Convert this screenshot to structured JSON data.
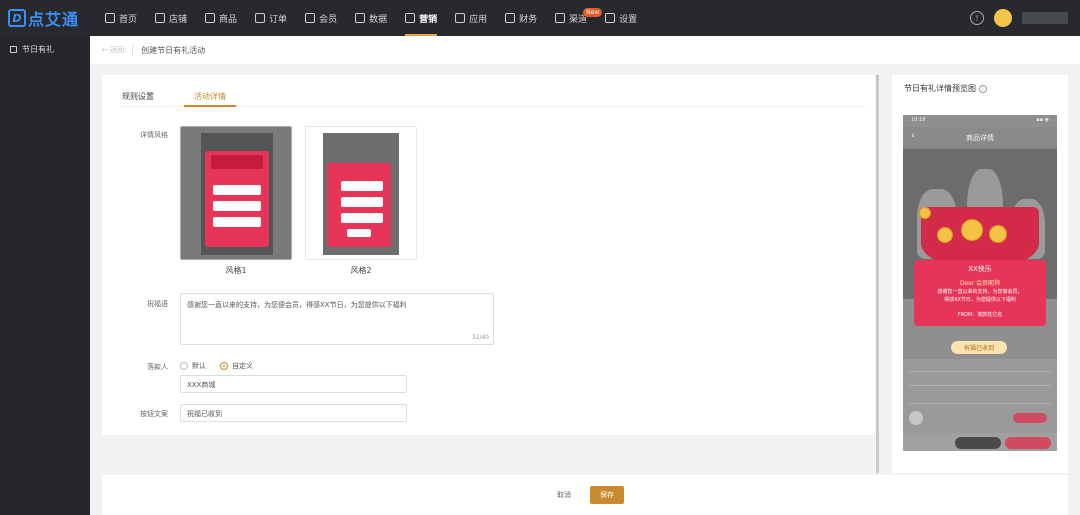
{
  "logo": {
    "text": "点艾通"
  },
  "nav": [
    {
      "label": "首页",
      "icon": "home-icon"
    },
    {
      "label": "店铺",
      "icon": "shop-icon"
    },
    {
      "label": "商品",
      "icon": "goods-icon"
    },
    {
      "label": "订单",
      "icon": "order-icon"
    },
    {
      "label": "会员",
      "icon": "member-icon"
    },
    {
      "label": "数据",
      "icon": "data-icon"
    },
    {
      "label": "营销",
      "icon": "tag-icon",
      "active": true
    },
    {
      "label": "应用",
      "icon": "app-icon"
    },
    {
      "label": "财务",
      "icon": "finance-icon"
    },
    {
      "label": "渠道",
      "icon": "channel-icon",
      "badge": "New"
    },
    {
      "label": "设置",
      "icon": "gear-icon"
    }
  ],
  "sidebar": {
    "items": [
      {
        "label": "节日有礼",
        "icon": "gift-icon"
      }
    ]
  },
  "breadcrumb": {
    "back": "返回",
    "title": "创建节日有礼活动"
  },
  "tabs": [
    {
      "label": "规则设置"
    },
    {
      "label": "活动详情",
      "active": true
    }
  ],
  "form": {
    "style_label": "详情风格",
    "styles": [
      {
        "caption": "风格1",
        "selected": true
      },
      {
        "caption": "风格2",
        "selected": false
      }
    ],
    "blessing_label": "祝福语",
    "blessing_value": "感谢您一直以来的支持，为您便会员，得感XX节日，为您提供以下福利",
    "blessing_count": "32/40",
    "signer_label": "落款人",
    "signer_options": [
      {
        "label": "默认",
        "checked": false
      },
      {
        "label": "自定义",
        "checked": true
      }
    ],
    "signer_value": "XXX商城",
    "button_label": "按钮文案",
    "button_value": "祝福已收到"
  },
  "preview": {
    "title": "节日有礼详情预览图",
    "time": "10:18",
    "header": "商品详情",
    "card_title": "XX快乐",
    "card_greeting": "Dear 会员昵称",
    "card_line1": "感谢您一直以来的支持，为您做会员，",
    "card_line2": "得感XX节日，为您提供以下福利",
    "card_from": "FROM：落款姓它名",
    "btn": "祝福已收到"
  },
  "footer": {
    "cancel": "取消",
    "save": "保存"
  },
  "colors": {
    "accent": "#c98a2e",
    "topbar": "#27292c",
    "card": "#e7355a"
  }
}
